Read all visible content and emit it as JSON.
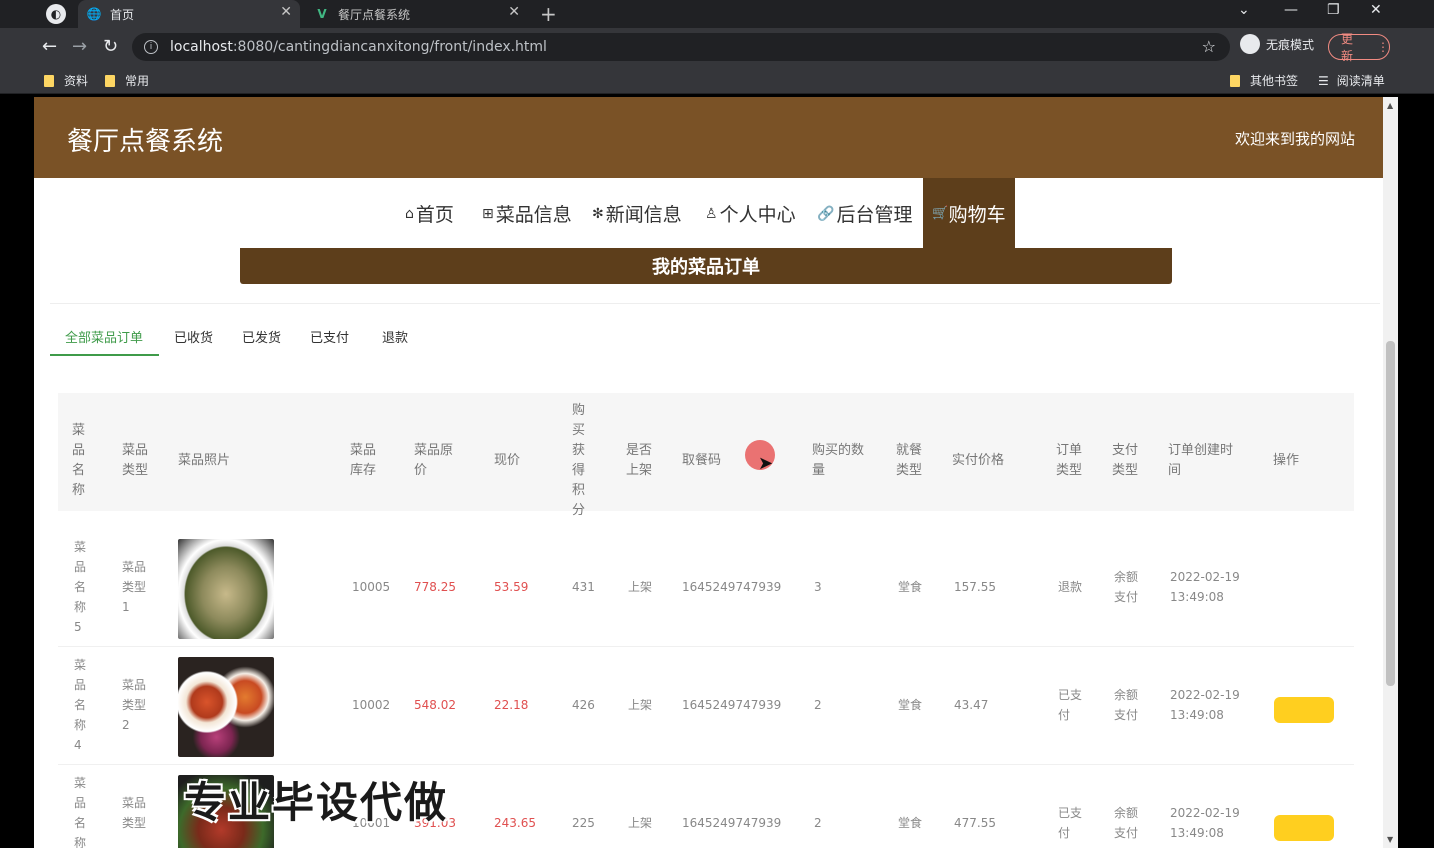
{
  "browser": {
    "tabs": [
      {
        "title": "首页",
        "active": true
      },
      {
        "title": "餐厅点餐系统",
        "active": false
      }
    ],
    "url_host": "localhost",
    "url_rest": ":8080/cantingdiancanxitong/front/index.html",
    "incognito_label": "无痕模式",
    "update_label": "更新",
    "bookmarks_left": [
      "资料",
      "常用"
    ],
    "bookmarks_right": [
      "其他书签",
      "阅读清单"
    ]
  },
  "site": {
    "title": "餐厅点餐系统",
    "welcome": "欢迎来到我的网站"
  },
  "nav": {
    "items": [
      {
        "icon": "⌂",
        "label": "首页"
      },
      {
        "icon": "⊞",
        "label": "菜品信息"
      },
      {
        "icon": "✻",
        "label": "新闻信息"
      },
      {
        "icon": "♙",
        "label": "个人中心"
      },
      {
        "icon": "🔗",
        "label": "后台管理"
      }
    ],
    "active_label": "购物车",
    "active_icon": "🛒"
  },
  "page_banner": "我的菜品订单",
  "order_tabs": [
    "全部菜品订单",
    "已收货",
    "已发货",
    "已支付",
    "退款"
  ],
  "table": {
    "headers": [
      "菜品名称",
      "菜品类型",
      "菜品照片",
      "菜品库存",
      "菜品原价",
      "现价",
      "购买获得积分",
      "是否上架",
      "取餐码",
      "购买的数量",
      "就餐类型",
      "实付价格",
      "订单类型",
      "支付类型",
      "订单创建时间",
      "操作"
    ],
    "rows": [
      {
        "name": "菜品名称5",
        "type": "菜品类型1",
        "stock": "10005",
        "orig": "778.25",
        "now": "53.59",
        "points": "431",
        "onsale": "上架",
        "code": "1645249747939",
        "qty": "3",
        "dine": "堂食",
        "paid": "157.55",
        "otype": "退款",
        "ptype": "余额支付",
        "created": "2022-02-19 13:49:08"
      },
      {
        "name": "菜品名称4",
        "type": "菜品类型2",
        "stock": "10002",
        "orig": "548.02",
        "now": "22.18",
        "points": "426",
        "onsale": "上架",
        "code": "1645249747939",
        "qty": "2",
        "dine": "堂食",
        "paid": "43.47",
        "otype": "已支付",
        "ptype": "余额支付",
        "created": "2022-02-19 13:49:08"
      },
      {
        "name": "菜品名称",
        "type": "菜品类型",
        "stock": "10001",
        "orig": "391.03",
        "now": "243.65",
        "points": "225",
        "onsale": "上架",
        "code": "1645249747939",
        "qty": "2",
        "dine": "堂食",
        "paid": "477.55",
        "otype": "已支付",
        "ptype": "余额支付",
        "created": "2022-02-19 13:49:08"
      }
    ]
  },
  "watermark": "专业毕设代做",
  "colors": {
    "header_brown": "#7a5226",
    "dark_brown": "#5d3e1b",
    "active_tab_green": "#3f9b4a",
    "price_red": "#e05050",
    "op_button_yellow": "#ffcf1f"
  }
}
